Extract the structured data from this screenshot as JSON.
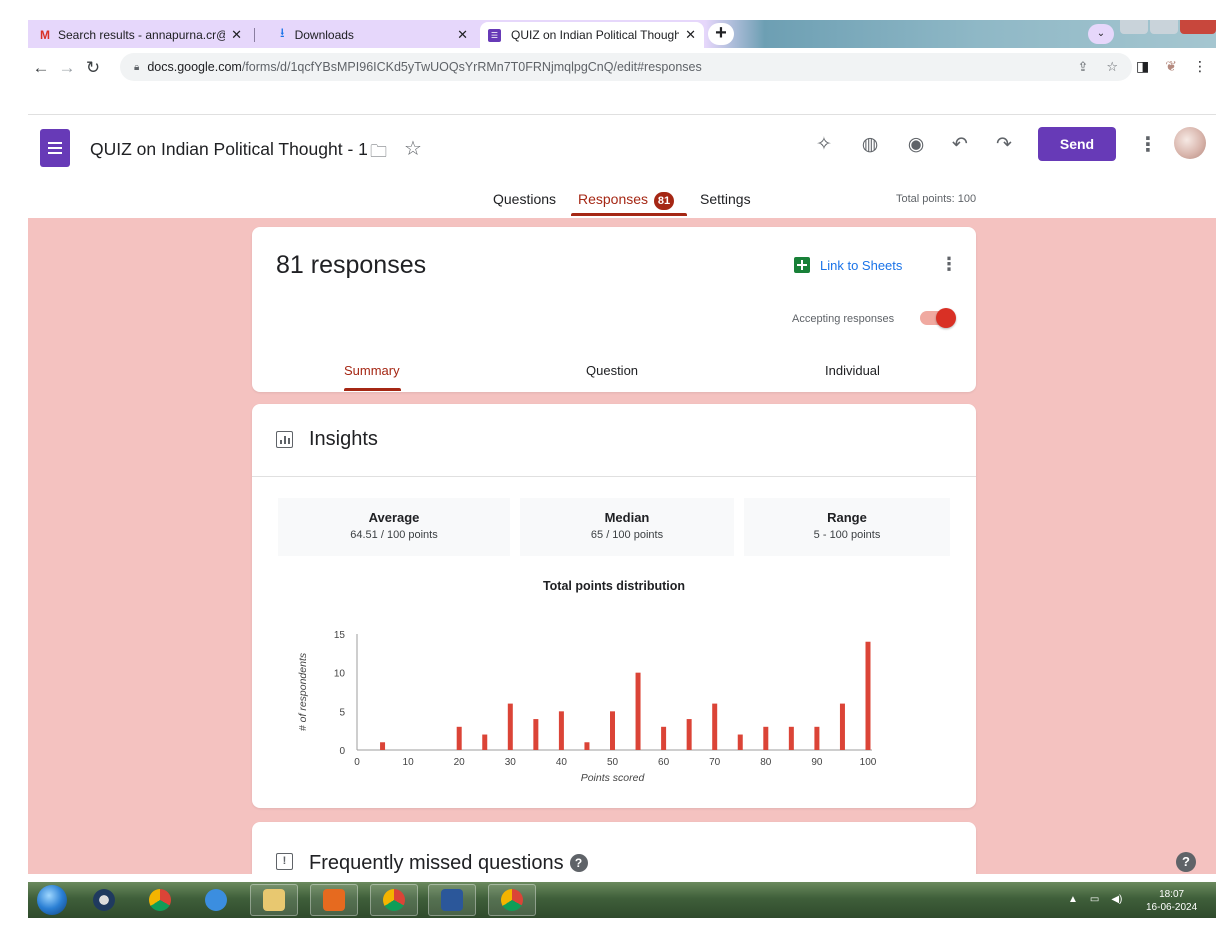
{
  "browser": {
    "tabs": [
      {
        "title": "Search results - annapurna.cr@g",
        "icon": "gmail-icon",
        "active": false
      },
      {
        "title": "Downloads",
        "icon": "download-icon",
        "active": false
      },
      {
        "title": "QUIZ on Indian Political Thought",
        "icon": "forms-icon",
        "active": true
      }
    ],
    "url_host": "docs.google.com",
    "url_path": "/forms/d/1qcfYBsMPI96ICKd5yTwUOQsYrRMn7T0FRNjmqlpgCnQ/edit#responses"
  },
  "header": {
    "doc_title": "QUIZ on Indian Political Thought - 1",
    "send_label": "Send",
    "icons": [
      "addon-icon",
      "palette-icon",
      "preview-icon",
      "undo-icon",
      "redo-icon",
      "more-vert-icon"
    ]
  },
  "main_tabs": {
    "questions": "Questions",
    "responses": "Responses",
    "responses_badge": "81",
    "settings": "Settings",
    "total_points": "Total points: 100"
  },
  "responses_card": {
    "count_text": "81 responses",
    "link_to_sheets": "Link to Sheets",
    "accepting_label": "Accepting responses",
    "accepting_on": true,
    "tabs": {
      "summary": "Summary",
      "question": "Question",
      "individual": "Individual"
    }
  },
  "insights": {
    "title": "Insights",
    "average_label": "Average",
    "average_value": "64.51 / 100 points",
    "median_label": "Median",
    "median_value": "65 / 100 points",
    "range_label": "Range",
    "range_value": "5 - 100 points"
  },
  "chart_data": {
    "type": "bar",
    "title": "Total points distribution",
    "xlabel": "Points scored",
    "ylabel": "# of respondents",
    "x": [
      5,
      20,
      25,
      30,
      35,
      40,
      45,
      50,
      55,
      60,
      65,
      70,
      75,
      80,
      85,
      90,
      95,
      100
    ],
    "values": [
      1,
      3,
      2,
      6,
      4,
      5,
      1,
      5,
      10,
      3,
      4,
      6,
      2,
      3,
      3,
      3,
      6,
      14
    ],
    "xlim": [
      0,
      100
    ],
    "ylim": [
      0,
      15
    ],
    "x_ticks": [
      0,
      10,
      20,
      30,
      40,
      50,
      60,
      70,
      80,
      90,
      100
    ],
    "y_ticks": [
      0,
      5,
      10,
      15
    ],
    "bar_color": "#db4437",
    "grid": false
  },
  "missed": {
    "title": "Frequently missed questions"
  },
  "taskbar": {
    "time": "18:07",
    "date": "16-06-2024"
  },
  "colors": {
    "accent": "#673ab7",
    "responses_red": "#a52714",
    "background": "#f4c2c0"
  }
}
